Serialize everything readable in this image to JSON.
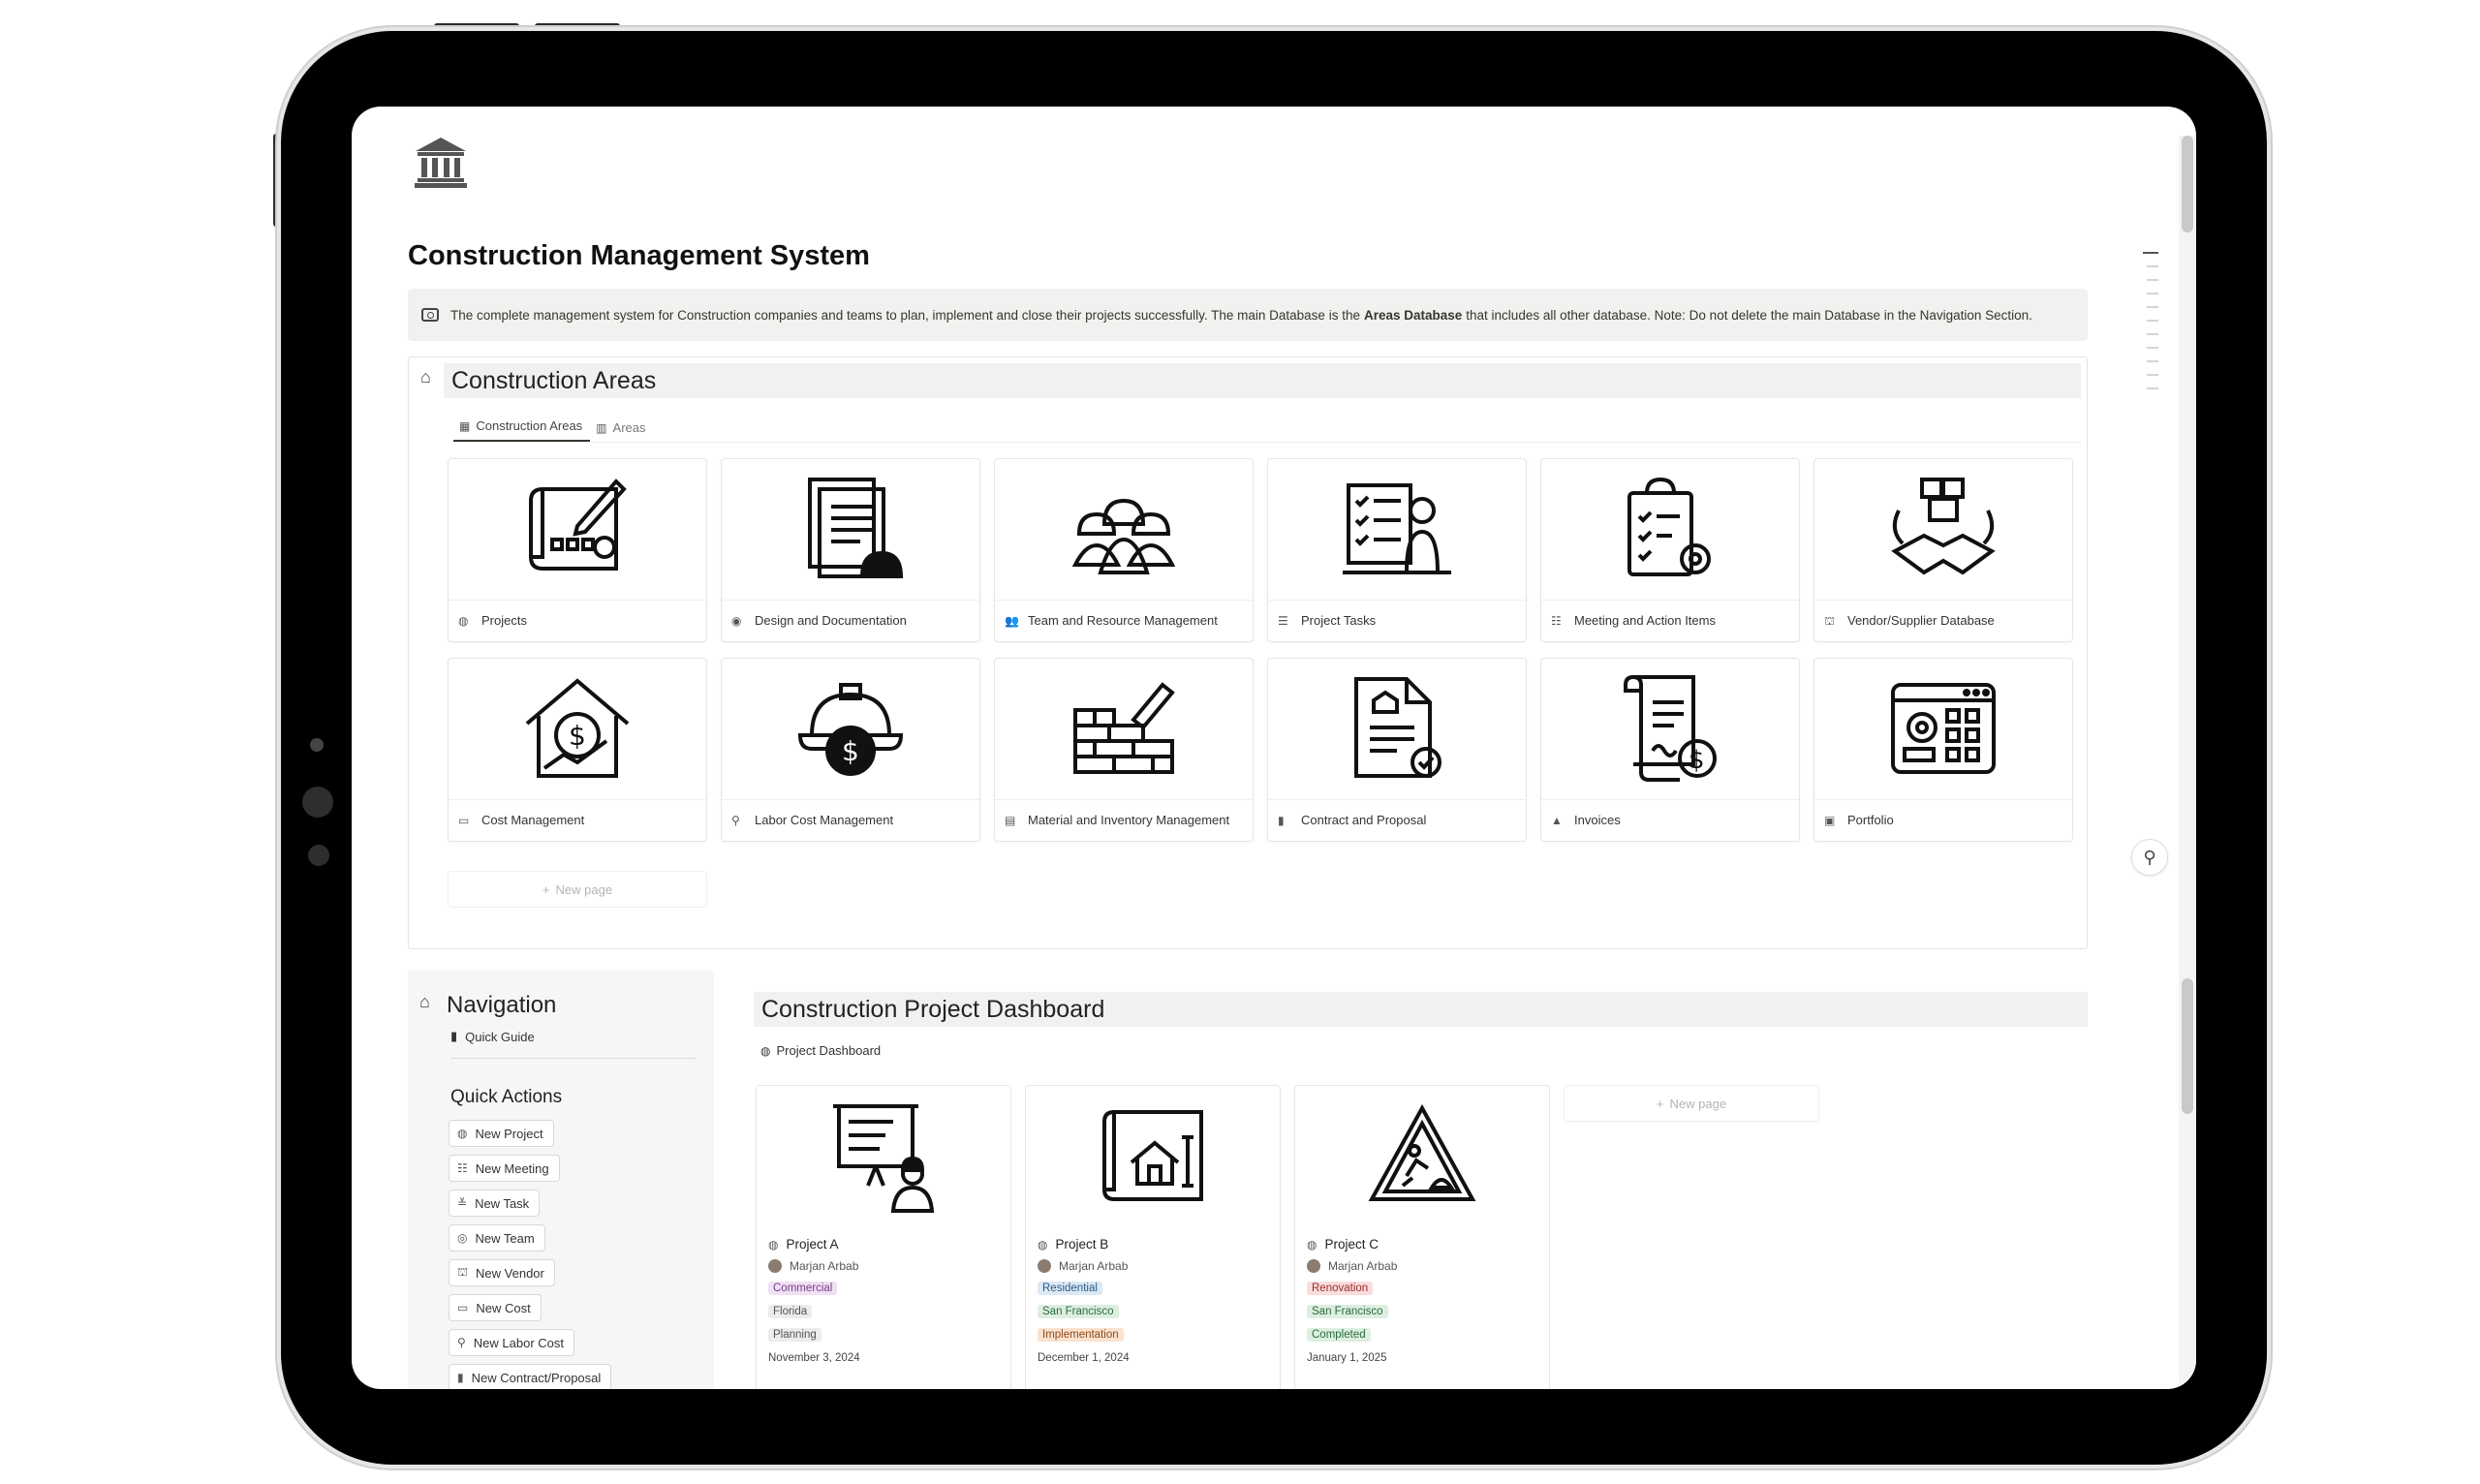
{
  "page": {
    "title": "Construction Management System",
    "callout": {
      "text_before": "The complete management system for Construction companies and teams to plan, implement and close their projects successfully. The main Database is the",
      "bold": "Areas Database",
      "text_after": "that includes all other database. Note: Do not delete the main Database in the Navigation Section."
    }
  },
  "areas": {
    "heading": "Construction Areas",
    "tabs": [
      {
        "label": "Construction Areas",
        "icon": "gallery-icon"
      },
      {
        "label": "Areas",
        "icon": "chart-icon"
      }
    ],
    "cards": [
      {
        "label": "Projects",
        "icon": "globe-icon"
      },
      {
        "label": "Design and Documentation",
        "icon": "palette-icon"
      },
      {
        "label": "Team and Resource Management",
        "icon": "people-icon"
      },
      {
        "label": "Project Tasks",
        "icon": "list-icon"
      },
      {
        "label": "Meeting and Action Items",
        "icon": "checklist-icon"
      },
      {
        "label": "Vendor/Supplier Database",
        "icon": "factory-icon"
      },
      {
        "label": "Cost Management",
        "icon": "cash-icon"
      },
      {
        "label": "Labor Cost Management",
        "icon": "pin-icon"
      },
      {
        "label": "Material and Inventory Management",
        "icon": "grid-icon"
      },
      {
        "label": "Contract and Proposal",
        "icon": "book-icon"
      },
      {
        "label": "Invoices",
        "icon": "stamp-icon"
      },
      {
        "label": "Portfolio",
        "icon": "image-icon"
      }
    ],
    "new_page": "New page"
  },
  "navigation": {
    "heading": "Navigation",
    "quick_guide": "Quick Guide",
    "quick_actions_heading": "Quick Actions",
    "actions": [
      {
        "label": "New Project",
        "icon": "globe-icon"
      },
      {
        "label": "New Meeting",
        "icon": "checklist-icon"
      },
      {
        "label": "New Task",
        "icon": "double-chevron-icon"
      },
      {
        "label": "New Team",
        "icon": "user-circle-icon"
      },
      {
        "label": "New Vendor",
        "icon": "factory-icon"
      },
      {
        "label": "New Cost",
        "icon": "cash-icon"
      },
      {
        "label": "New Labor Cost",
        "icon": "pin-icon"
      },
      {
        "label": "New Contract/Proposal",
        "icon": "book-icon"
      }
    ]
  },
  "dashboard": {
    "heading": "Construction Project Dashboard",
    "tab": "Project Dashboard",
    "new_page": "New page",
    "projects": [
      {
        "name": "Project A",
        "owner": "Marjan Arbab",
        "type": "Commercial",
        "location": "Florida",
        "status": "Planning",
        "date": "November 3, 2024",
        "type_color": "#efe0f3",
        "type_text": "#7a3e8c",
        "loc_color": "#ececea",
        "loc_text": "#555",
        "status_color": "#ececea",
        "status_text": "#555"
      },
      {
        "name": "Project B",
        "owner": "Marjan Arbab",
        "type": "Residential",
        "location": "San Francisco",
        "status": "Implementation",
        "date": "December 1, 2024",
        "type_color": "#dbe9f5",
        "type_text": "#2c5b85",
        "loc_color": "#dcefe0",
        "loc_text": "#2d6a3e",
        "status_color": "#fbe2cf",
        "status_text": "#8a4b1c"
      },
      {
        "name": "Project C",
        "owner": "Marjan Arbab",
        "type": "Renovation",
        "location": "San Francisco",
        "status": "Completed",
        "date": "January 1, 2025",
        "type_color": "#fadcdc",
        "type_text": "#9a2f2f",
        "loc_color": "#dcefe0",
        "loc_text": "#2d6a3e",
        "status_color": "#dcefe0",
        "status_text": "#2d6a3e"
      }
    ]
  }
}
